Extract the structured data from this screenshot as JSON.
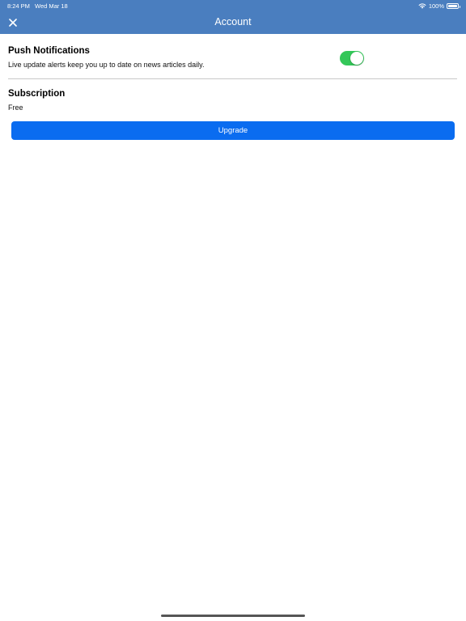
{
  "status_bar": {
    "time": "8:24 PM",
    "date": "Wed Mar 18",
    "battery_percent": "100%",
    "icons": [
      "wifi-icon",
      "battery-icon"
    ]
  },
  "nav": {
    "title": "Account",
    "close_icon": "close-icon"
  },
  "push_notifications": {
    "title": "Push Notifications",
    "description": "Live update alerts keep you up to date on news articles daily.",
    "enabled": true
  },
  "subscription": {
    "title": "Subscription",
    "plan": "Free",
    "upgrade_label": "Upgrade"
  },
  "colors": {
    "header": "#4a7ebf",
    "toggle_on": "#34c759",
    "button": "#0a6cf0"
  }
}
